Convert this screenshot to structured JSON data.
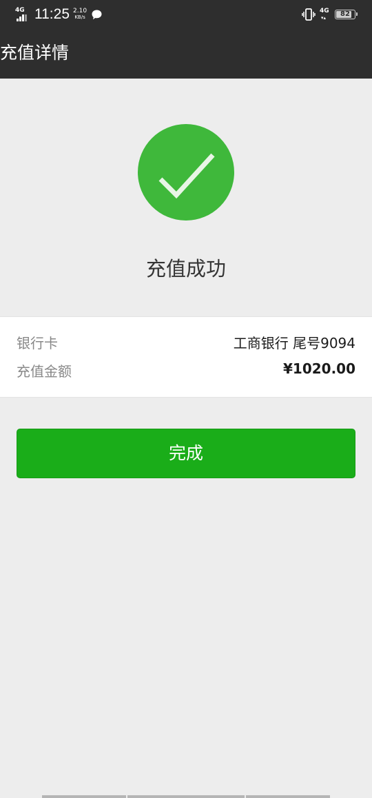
{
  "status_bar": {
    "network_left": "4G",
    "time": "11:25",
    "speed_value": "2.10",
    "speed_unit": "KB/s",
    "network_right": "4G",
    "battery": "82",
    "icons": [
      "signal-icon",
      "chat-notification-icon",
      "vibrate-icon",
      "data-arrows-icon",
      "battery-icon"
    ]
  },
  "header": {
    "title": "充值详情"
  },
  "result": {
    "icon": "check-circle-icon",
    "message": "充值成功"
  },
  "details": {
    "rows": [
      {
        "label": "银行卡",
        "value": "工商银行 尾号9094"
      },
      {
        "label": "充值金额",
        "value": "¥1020.00"
      }
    ]
  },
  "actions": {
    "done_label": "完成"
  },
  "colors": {
    "header_bg": "#2e2e2e",
    "page_bg": "#ededed",
    "success_green": "#3fb83b",
    "button_green": "#1aad19"
  }
}
